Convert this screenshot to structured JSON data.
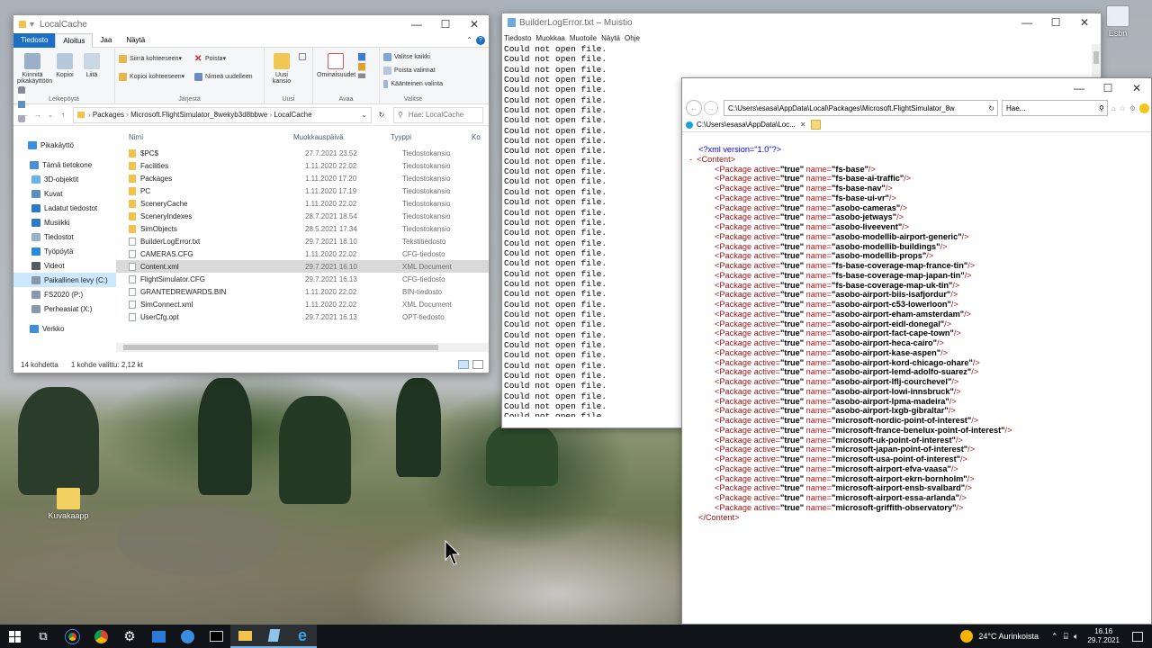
{
  "desktop": {
    "icons": [
      {
        "label": "Kuvakaapp"
      },
      {
        "label": "Esbn"
      }
    ]
  },
  "explorer": {
    "title": "LocalCache",
    "ribbon_tabs": [
      "Tiedosto",
      "Aloitus",
      "Jaa",
      "Näytä"
    ],
    "ribbon": {
      "pin_label": "Kiinnitä pikakäyttöön",
      "copy_label": "Kopioi",
      "paste_label": "Liitä",
      "group_clipboard": "Leikepöytä",
      "move_label": "Siirrä kohteeseen",
      "copyto_label": "Kopioi kohteeseen",
      "delete_label": "Poista",
      "rename_label": "Nimeä uudelleen",
      "group_organize": "Järjestä",
      "newfolder_label": "Uusi kansio",
      "group_new": "Uusi",
      "properties_label": "Ominaisuudet",
      "group_open": "Avaa",
      "selectall_label": "Valitse kaikki",
      "selectnone_label": "Poista valinnat",
      "invert_label": "Käänteinen valinta",
      "group_select": "Valitse"
    },
    "breadcrumb": [
      "Packages",
      "Microsoft.FlightSimulator_8wekyb3d8bbwe",
      "LocalCache"
    ],
    "search_placeholder": "Hae: LocalCache",
    "nav_items": [
      {
        "label": "Pikakäyttö",
        "color": "#3c8ee0"
      },
      {
        "label": "Tämä tietokone",
        "color": "#4a90d9"
      },
      {
        "label": "3D-objektit",
        "color": "#6cb4e8"
      },
      {
        "label": "Kuvat",
        "color": "#5a8fc0"
      },
      {
        "label": "Ladatut tiedostot",
        "color": "#2a7ac8"
      },
      {
        "label": "Musiikki",
        "color": "#2a7ac8"
      },
      {
        "label": "Tiedostot",
        "color": "#9ab0c8"
      },
      {
        "label": "Työpöytä",
        "color": "#2a8ae0"
      },
      {
        "label": "Videot",
        "color": "#555a66"
      },
      {
        "label": "Paikallinen levy (C:)",
        "color": "#8898a8"
      },
      {
        "label": "FS2020 (P:)",
        "color": "#8898a8"
      },
      {
        "label": "Perheasiat (X:)",
        "color": "#8898a8"
      },
      {
        "label": "Verkko",
        "color": "#3c8ee0"
      }
    ],
    "columns": {
      "name": "Nimi",
      "modified": "Muokkauspäivä",
      "type": "Tyyppi",
      "size": "Ko"
    },
    "files": [
      {
        "name": "$PC$",
        "date": "27.7.2021 23.52",
        "type": "Tiedostokansio",
        "icon": "folder"
      },
      {
        "name": "Facilities",
        "date": "1.11.2020 22.02",
        "type": "Tiedostokansio",
        "icon": "folder"
      },
      {
        "name": "Packages",
        "date": "1.11.2020 17.20",
        "type": "Tiedostokansio",
        "icon": "folder"
      },
      {
        "name": "PC",
        "date": "1.11.2020 17.19",
        "type": "Tiedostokansio",
        "icon": "folder"
      },
      {
        "name": "SceneryCache",
        "date": "1.11.2020 22.02",
        "type": "Tiedostokansio",
        "icon": "folder"
      },
      {
        "name": "SceneryIndexes",
        "date": "28.7.2021 18.54",
        "type": "Tiedostokansio",
        "icon": "folder"
      },
      {
        "name": "SimObjects",
        "date": "28.5.2021 17.34",
        "type": "Tiedostokansio",
        "icon": "folder"
      },
      {
        "name": "BuilderLogError.txt",
        "date": "29.7.2021 16.10",
        "type": "Tekstitiedosto",
        "icon": "file"
      },
      {
        "name": "CAMERAS.CFG",
        "date": "1.11.2020 22.02",
        "type": "CFG-tiedosto",
        "icon": "file"
      },
      {
        "name": "Content.xml",
        "date": "29.7.2021 16.10",
        "type": "XML Document",
        "icon": "file"
      },
      {
        "name": "FlightSimulator.CFG",
        "date": "29.7.2021 16.13",
        "type": "CFG-tiedosto",
        "icon": "file"
      },
      {
        "name": "GRANTEDREWARDS.BIN",
        "date": "1.11.2020 22.02",
        "type": "BIN-tiedosto",
        "icon": "file"
      },
      {
        "name": "SimConnect.xml",
        "date": "1.11.2020 22.02",
        "type": "XML Document",
        "icon": "file"
      },
      {
        "name": "UserCfg.opt",
        "date": "29.7.2021 16.13",
        "type": "OPT-tiedosto",
        "icon": "file"
      }
    ],
    "status_count": "14 kohdetta",
    "status_selected": "1 kohde valittu: 2,12 kt"
  },
  "notepad": {
    "title": "BuilderLogError.txt – Muistio",
    "menu": [
      "Tiedosto",
      "Muokkaa",
      "Muotoile",
      "Näytä",
      "Ohje"
    ],
    "line_text": "Could not open file.",
    "line_count": 37
  },
  "ie": {
    "url": "C:\\Users\\esasa\\AppData\\Local\\Packages\\Microsoft.FlightSimulator_8w",
    "search_placeholder": "Hae...",
    "tab_label": "C:\\Users\\esasa\\AppData\\Loc...",
    "xml_decl": "<?xml version=\"1.0\"?>",
    "collapse": "-",
    "open_tag": "<Content>",
    "close_tag": "</Content>",
    "pkg_prefix": "<Package active=",
    "pkg_active": "\"true\"",
    "pkg_name_attr": " name=",
    "pkg_suffix": "/>",
    "packages": [
      "fs-base",
      "fs-base-ai-traffic",
      "fs-base-nav",
      "fs-base-ui-vr",
      "asobo-cameras",
      "asobo-jetways",
      "asobo-liveevent",
      "asobo-modellib-airport-generic",
      "asobo-modellib-buildings",
      "asobo-modellib-props",
      "fs-base-coverage-map-france-tin",
      "fs-base-coverage-map-japan-tin",
      "fs-base-coverage-map-uk-tin",
      "asobo-airport-biis-isafjordur",
      "asobo-airport-c53-lowerloon",
      "asobo-airport-eham-amsterdam",
      "asobo-airport-eidl-donegal",
      "asobo-airport-fact-cape-town",
      "asobo-airport-heca-cairo",
      "asobo-airport-kase-aspen",
      "asobo-airport-kord-chicago-ohare",
      "asobo-airport-lemd-adolfo-suarez",
      "asobo-airport-lflj-courchevel",
      "asobo-airport-lowi-innsbruck",
      "asobo-airport-lpma-madeira",
      "asobo-airport-lxgb-gibraltar",
      "microsoft-nordic-point-of-interest",
      "microsoft-france-benelux-point-of-interest",
      "microsoft-uk-point-of-interest",
      "microsoft-japan-point-of-interest",
      "microsoft-usa-point-of-interest",
      "microsoft-airport-efva-vaasa",
      "microsoft-airport-ekrn-bornholm",
      "microsoft-airport-ensb-svalbard",
      "microsoft-airport-essa-arlanda",
      "microsoft-griffith-observatory"
    ]
  },
  "taskbar": {
    "weather": "24°C Aurinkoista",
    "time": "16.16",
    "date": "29.7.2021"
  },
  "colors": {
    "accent": "#1a6fc4",
    "taskbar": "#101418"
  }
}
